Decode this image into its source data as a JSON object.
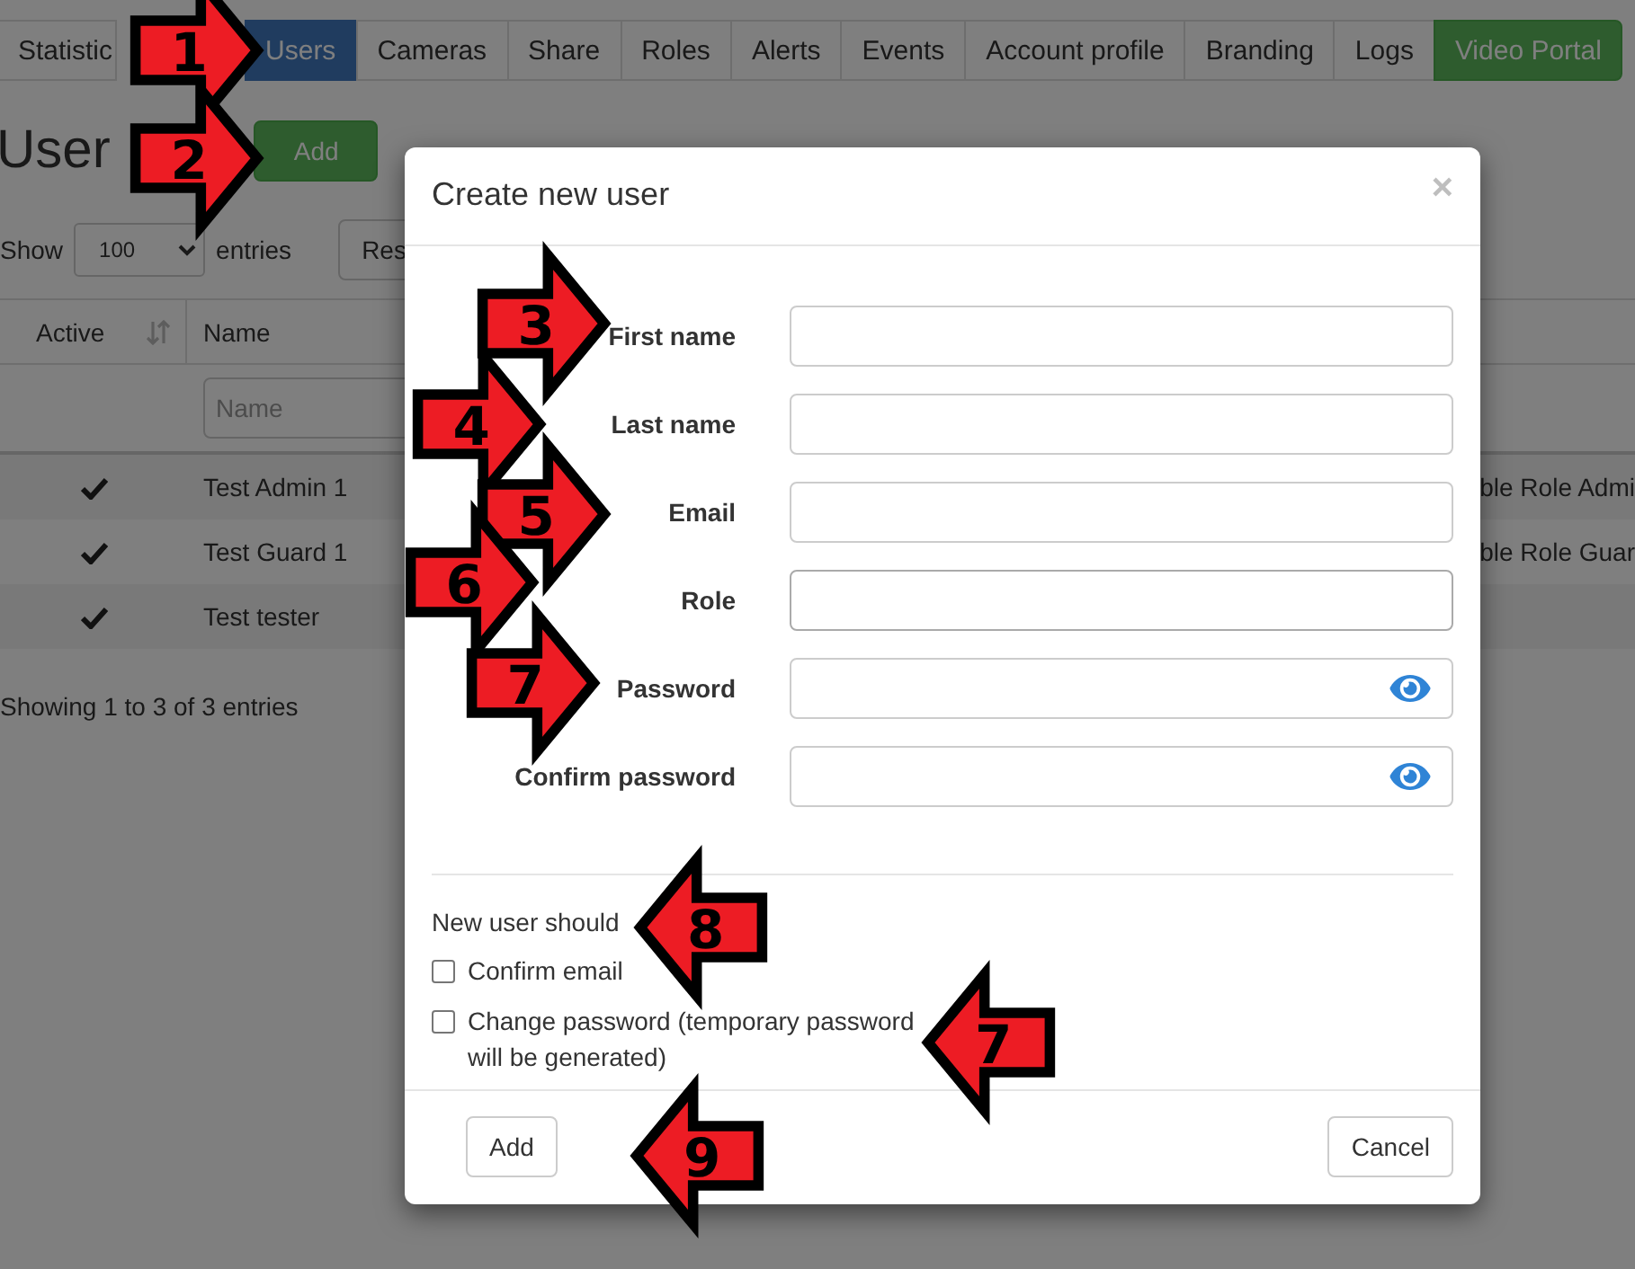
{
  "nav_tabs": [
    {
      "label": "Statistic",
      "selected": false,
      "kind": "plain"
    },
    {
      "label": "Users",
      "selected": true,
      "kind": "plain"
    },
    {
      "label": "Cameras",
      "selected": false,
      "kind": "plain"
    },
    {
      "label": "Share",
      "selected": false,
      "kind": "plain"
    },
    {
      "label": "Roles",
      "selected": false,
      "kind": "plain"
    },
    {
      "label": "Alerts",
      "selected": false,
      "kind": "plain"
    },
    {
      "label": "Events",
      "selected": false,
      "kind": "plain"
    },
    {
      "label": "Account profile",
      "selected": false,
      "kind": "plain"
    },
    {
      "label": "Branding",
      "selected": false,
      "kind": "plain"
    },
    {
      "label": "Logs",
      "selected": false,
      "kind": "plain"
    },
    {
      "label": "Video Portal",
      "selected": false,
      "kind": "accent"
    }
  ],
  "page_title": "User",
  "add_button": "Add",
  "length_control": {
    "prefix": "Show",
    "value": "100",
    "suffix": "entries"
  },
  "reset_button": "Res",
  "table": {
    "columns": [
      "Active",
      "Name"
    ],
    "filter_placeholder": "Name",
    "rows": [
      {
        "active": true,
        "name": "Test Admin 1",
        "column_3": "ble Role Admi"
      },
      {
        "active": true,
        "name": "Test Guard 1",
        "column_3": "ble Role Guar"
      },
      {
        "active": true,
        "name": "Test tester"
      }
    ]
  },
  "table_info": "Showing 1 to 3 of 3 entries",
  "modal": {
    "title": "Create new user",
    "close": "×",
    "fields": [
      {
        "label": "First name",
        "kind": "text"
      },
      {
        "label": "Last name",
        "kind": "text"
      },
      {
        "label": "Email",
        "kind": "text"
      },
      {
        "label": "Role",
        "kind": "select"
      },
      {
        "label": "Password",
        "kind": "password"
      },
      {
        "label": "Confirm password",
        "kind": "password"
      }
    ],
    "options_title": "New user should",
    "options": [
      {
        "label": "Confirm email",
        "checked": false
      },
      {
        "label": "Change password (temporary password will be generated)",
        "checked": false
      }
    ],
    "buttons": [
      "Add",
      "Cancel"
    ]
  },
  "callouts": [
    {
      "number": "1",
      "kind": "right"
    },
    {
      "number": "2",
      "kind": "right"
    },
    {
      "number": "3",
      "kind": "right"
    },
    {
      "number": "4",
      "kind": "right"
    },
    {
      "number": "5",
      "kind": "right"
    },
    {
      "number": "6",
      "kind": "right"
    },
    {
      "number": "7",
      "kind": "right"
    },
    {
      "number": "8",
      "kind": "left"
    },
    {
      "number": "7",
      "kind": "left"
    },
    {
      "number": "9",
      "kind": "left"
    }
  ]
}
